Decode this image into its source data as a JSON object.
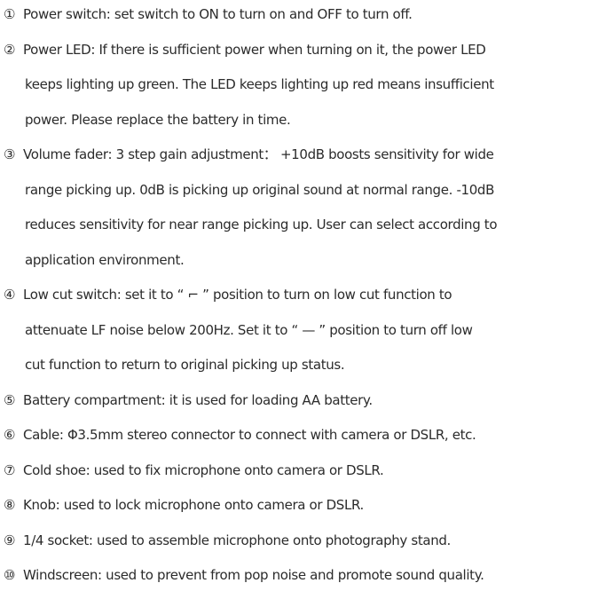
{
  "items": [
    {
      "num": "①",
      "lines": [
        "Power switch: set switch to ON to turn on and OFF to turn off."
      ]
    },
    {
      "num": "②",
      "lines": [
        "Power LED: If there is sufficient power when turning on it, the power LED",
        "keeps lighting up green. The LED keeps lighting up red means insufficient",
        "power. Please replace the battery in time."
      ]
    },
    {
      "num": "③",
      "lines": [
        "Volume fader: 3 step gain adjustment：  +10dB boosts sensitivity for wide",
        "range picking up. 0dB is picking up original sound at normal range. -10dB",
        "reduces sensitivity for near range picking up. User can select according to",
        "application environment."
      ]
    },
    {
      "num": "④",
      "lines": [
        "Low cut switch: set it to  “ ⌐ ”  position to turn on low cut function to",
        "attenuate LF noise below 200Hz. Set it to  “ — ”  position to turn off low",
        "cut function to return to original picking up status."
      ]
    },
    {
      "num": "⑤",
      "lines": [
        "Battery compartment: it is used for loading AA battery."
      ]
    },
    {
      "num": "⑥",
      "lines": [
        "Cable: Φ3.5mm stereo connector to connect with camera or DSLR, etc."
      ]
    },
    {
      "num": "⑦",
      "lines": [
        "Cold shoe: used to fix microphone onto camera or DSLR."
      ]
    },
    {
      "num": "⑧",
      "lines": [
        "Knob: used to lock microphone onto camera or DSLR."
      ]
    },
    {
      "num": "⑨",
      "lines": [
        "1/4 socket: used to assemble microphone onto photography stand."
      ]
    },
    {
      "num": "⑩",
      "lines": [
        "Windscreen: used to prevent from pop noise and promote sound quality."
      ]
    }
  ]
}
